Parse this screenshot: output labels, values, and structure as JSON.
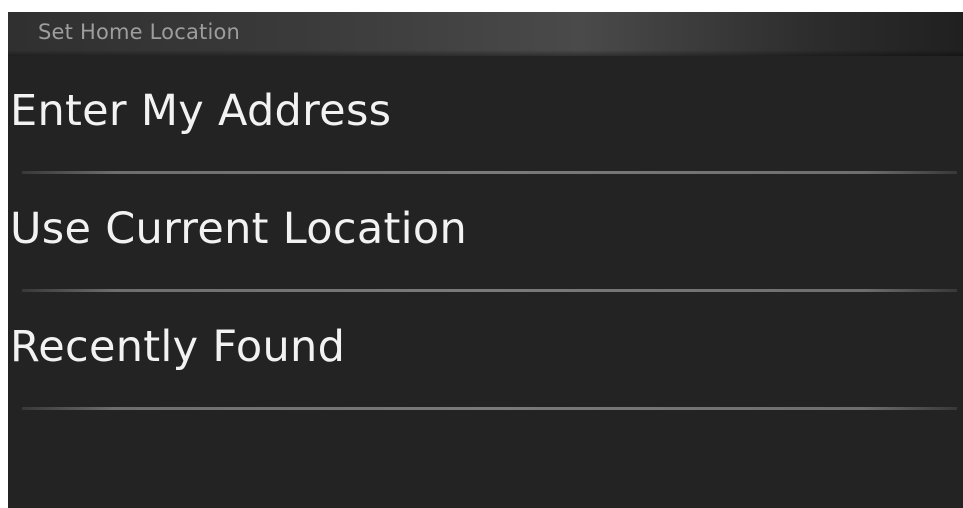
{
  "header": {
    "title": "Set Home Location"
  },
  "menu": {
    "items": [
      {
        "label": "Enter My Address"
      },
      {
        "label": "Use Current Location"
      },
      {
        "label": "Recently Found"
      }
    ]
  }
}
